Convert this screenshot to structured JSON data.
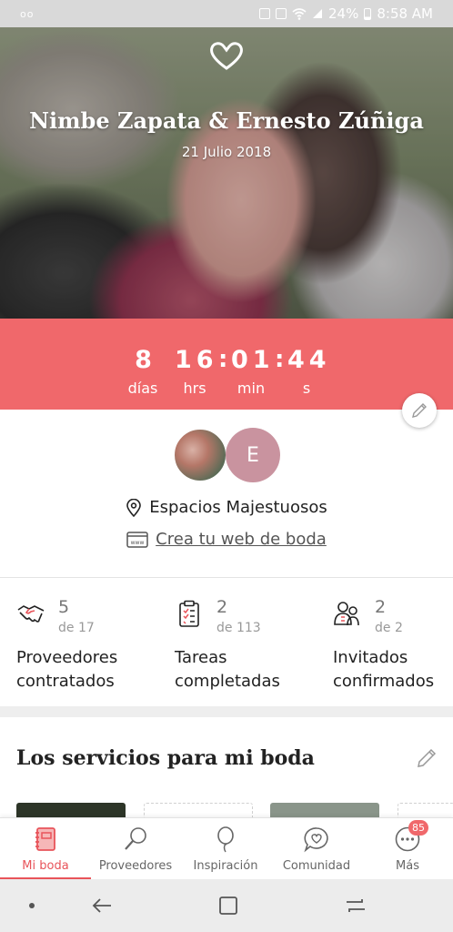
{
  "status_bar": {
    "left": "oo",
    "battery": "24%",
    "time": "8:58 AM"
  },
  "hero": {
    "names": "Nimbe Zapata & Ernesto Zúñiga",
    "date": "21 Julio 2018",
    "icons": [
      "heart-icon"
    ]
  },
  "countdown": {
    "days": "8",
    "hours": "16",
    "minutes": "01",
    "seconds": "44",
    "days_label": "días",
    "hours_label": "hrs",
    "minutes_label": "min",
    "seconds_label": "s"
  },
  "profile": {
    "avatar_initial": "E",
    "venue": "Espacios Majestuosos",
    "web_link": "Crea tu web de boda"
  },
  "stats": [
    {
      "value": "5",
      "of": "de 17",
      "label_line1": "Proveedores",
      "label_line2": "contratados",
      "icon": "handshake-icon"
    },
    {
      "value": "2",
      "of": "de 113",
      "label_line1": "Tareas",
      "label_line2": "completadas",
      "icon": "clipboard-icon"
    },
    {
      "value": "2",
      "of": "de 2",
      "label_line1": "Invitados",
      "label_line2": "confirmados",
      "icon": "guests-icon"
    }
  ],
  "services": {
    "title": "Los servicios para mi boda"
  },
  "tabs": [
    {
      "label": "Mi boda",
      "active": true
    },
    {
      "label": "Proveedores",
      "active": false
    },
    {
      "label": "Inspiración",
      "active": false
    },
    {
      "label": "Comunidad",
      "active": false
    },
    {
      "label": "Más",
      "active": false,
      "badge": "85"
    }
  ],
  "colors": {
    "accent": "#f0686b",
    "active_tab": "#e8545a",
    "avatar": "#c9939f"
  }
}
